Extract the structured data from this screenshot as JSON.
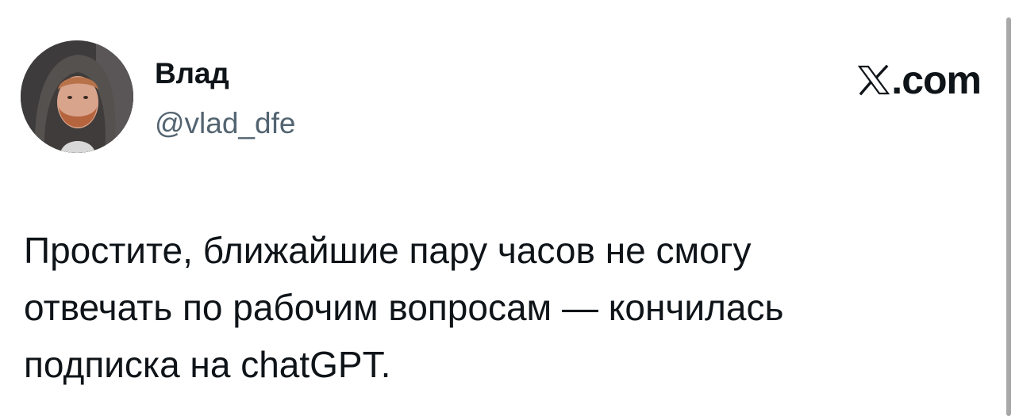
{
  "author": {
    "name": "Влад",
    "handle": "@vlad_dfe",
    "avatar_icon": "user-avatar-photo"
  },
  "brand": {
    "logo_icon": "x-logo-icon",
    "text": ".com"
  },
  "tweet": {
    "lines": [
      "Простите, ближайшие пару часов не смогу",
      "отвечать по рабочим вопросам — кончилась",
      "подписка на chatGPT."
    ]
  },
  "colors": {
    "text_primary": "#0f1419",
    "text_secondary": "#536471",
    "background": "#ffffff"
  }
}
